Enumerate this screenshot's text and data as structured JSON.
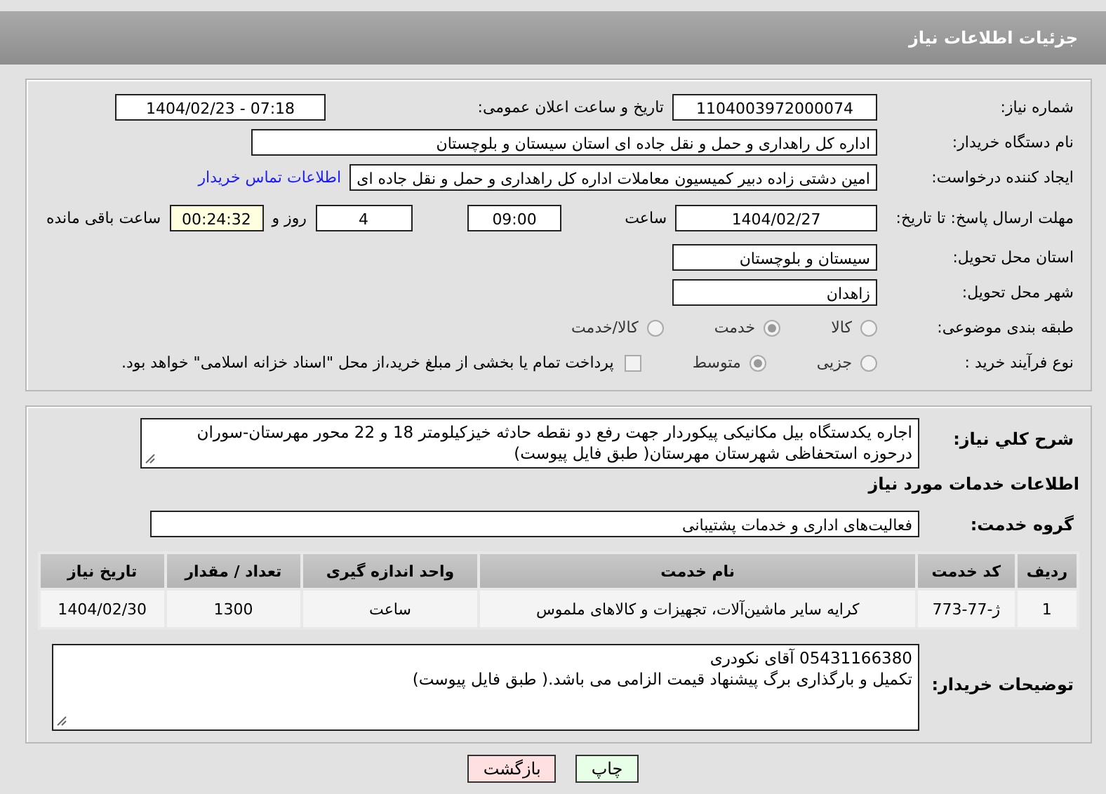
{
  "header": {
    "title": "جزئیات اطلاعات نیاز"
  },
  "details": {
    "need_number": {
      "label": "شماره نیاز:",
      "value": "1104003972000074"
    },
    "announce_datetime": {
      "label": "تاریخ و ساعت اعلان عمومی:",
      "value": "1404/02/23 - 07:18"
    },
    "buyer_org": {
      "label": "نام دستگاه خریدار:",
      "value": "اداره کل راهداری و حمل و نقل جاده ای استان سیستان و بلوچستان"
    },
    "requester": {
      "label": "ایجاد کننده درخواست:",
      "value": "امین دشتی زاده دبیر کمیسیون معاملات اداره کل راهداری و حمل و نقل جاده ای",
      "link": "اطلاعات تماس خریدار"
    },
    "deadline": {
      "label": "مهلت ارسال پاسخ: تا تاریخ:",
      "date": "1404/02/27",
      "time_label": "ساعت",
      "time": "09:00",
      "days": "4",
      "days_label": "روز و",
      "remaining": "00:24:32",
      "remaining_label": "ساعت باقی مانده"
    },
    "province": {
      "label": "استان محل تحویل:",
      "value": "سیستان و بلوچستان"
    },
    "city": {
      "label": "شهر محل تحویل:",
      "value": "زاهدان"
    },
    "category": {
      "label": "طبقه بندی موضوعی:",
      "options": [
        {
          "label": "کالا",
          "selected": false
        },
        {
          "label": "خدمت",
          "selected": true
        },
        {
          "label": "کالا/خدمت",
          "selected": false
        }
      ]
    },
    "process": {
      "label": "نوع فرآیند خرید :",
      "options": [
        {
          "label": "جزیی",
          "selected": false
        },
        {
          "label": "متوسط",
          "selected": true
        }
      ],
      "payment_note": {
        "checked": false,
        "text": "پرداخت تمام یا بخشی از مبلغ خرید،از محل \"اسناد خزانه اسلامی\" خواهد بود."
      }
    }
  },
  "summary": {
    "label": "شرح کلي نياز:",
    "value": "اجاره یکدستگاه بیل مکانیکی پیکوردار جهت رفع دو نقطه حادثه خیزکیلومتر 18 و 22 محور مهرستان-سوران درحوزه استحفاظی شهرستان مهرستان( طبق فایل پیوست)"
  },
  "services": {
    "title": "اطلاعات خدمات مورد نیاز",
    "group": {
      "label": "گروه خدمت:",
      "value": "فعالیت‌های اداری و خدمات پشتیبانی"
    },
    "table": {
      "columns": [
        "ردیف",
        "کد خدمت",
        "نام خدمت",
        "واحد اندازه گیری",
        "تعداد / مقدار",
        "تاریخ نیاز"
      ],
      "rows": [
        [
          "1",
          "ژ-77-773",
          "کرایه سایر ماشین‌آلات، تجهیزات و کالاهای ملموس",
          "ساعت",
          "1300",
          "1404/02/30"
        ]
      ]
    }
  },
  "buyer_notes": {
    "label": "توضیحات خریدار:",
    "lines": [
      "05431166380 آقای نکودری",
      "تکمیل و بارگذاری برگ پیشنهاد قیمت الزامی می باشد.( طبق فایل پیوست)"
    ]
  },
  "buttons": [
    {
      "label": "چاپ",
      "kind": "print"
    },
    {
      "label": "بازگشت",
      "kind": "back"
    }
  ]
}
